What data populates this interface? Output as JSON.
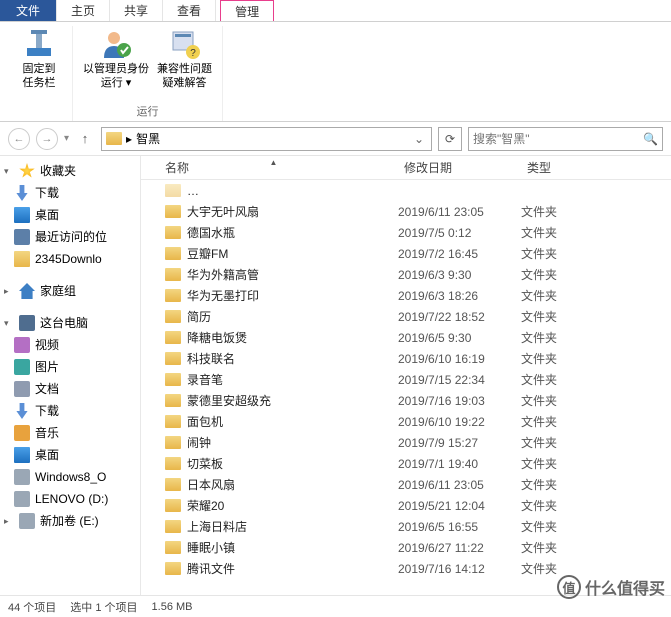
{
  "tabs": {
    "file": "文件",
    "home": "主页",
    "share": "共享",
    "view": "查看",
    "manage": "管理"
  },
  "ribbon": {
    "pin": {
      "l1": "固定到",
      "l2": "任务栏"
    },
    "admin": {
      "l1": "以管理员身份",
      "l2": "运行 ▾"
    },
    "compat": {
      "l1": "兼容性问题",
      "l2": "疑难解答"
    },
    "group": "运行"
  },
  "address": {
    "path": "智黑",
    "search_placeholder": "搜索\"智黑\""
  },
  "columns": {
    "name": "名称",
    "date": "修改日期",
    "type": "类型"
  },
  "type_folder": "文件夹",
  "files": [
    {
      "name": "大宇无叶风扇",
      "date": "2019/6/11 23:05"
    },
    {
      "name": "德国水瓶",
      "date": "2019/7/5 0:12"
    },
    {
      "name": "豆瓣FM",
      "date": "2019/7/2 16:45"
    },
    {
      "name": "华为外籍高管",
      "date": "2019/6/3 9:30"
    },
    {
      "name": "华为无墨打印",
      "date": "2019/6/3 18:26"
    },
    {
      "name": "简历",
      "date": "2019/7/22 18:52"
    },
    {
      "name": "降糖电饭煲",
      "date": "2019/6/5 9:30"
    },
    {
      "name": "科技联名",
      "date": "2019/6/10 16:19"
    },
    {
      "name": "录音笔",
      "date": "2019/7/15 22:34"
    },
    {
      "name": "蒙德里安超级充",
      "date": "2019/7/16 19:03"
    },
    {
      "name": "面包机",
      "date": "2019/6/10 19:22"
    },
    {
      "name": "闹钟",
      "date": "2019/7/9 15:27"
    },
    {
      "name": "切菜板",
      "date": "2019/7/1 19:40"
    },
    {
      "name": "日本风扇",
      "date": "2019/6/11 23:05"
    },
    {
      "name": "荣耀20",
      "date": "2019/5/21 12:04"
    },
    {
      "name": "上海日料店",
      "date": "2019/6/5 16:55"
    },
    {
      "name": "睡眠小镇",
      "date": "2019/6/27 11:22"
    },
    {
      "name": "腾讯文件",
      "date": "2019/7/16 14:12"
    }
  ],
  "sidebar": {
    "favorites": "收藏夹",
    "downloads": "下载",
    "desktop": "桌面",
    "recent": "最近访问的位",
    "d2345": "2345Downlo",
    "homegroup": "家庭组",
    "thispc": "这台电脑",
    "video": "视频",
    "pictures": "图片",
    "documents": "文档",
    "downloads2": "下载",
    "music": "音乐",
    "desktop2": "桌面",
    "win8": "Windows8_O",
    "lenovo": "LENOVO (D:)",
    "newvol": "新加卷 (E:)"
  },
  "status": {
    "count": "44 个项目",
    "selection": "选中 1 个项目",
    "size": "1.56 MB"
  },
  "watermark": "什么值得买"
}
